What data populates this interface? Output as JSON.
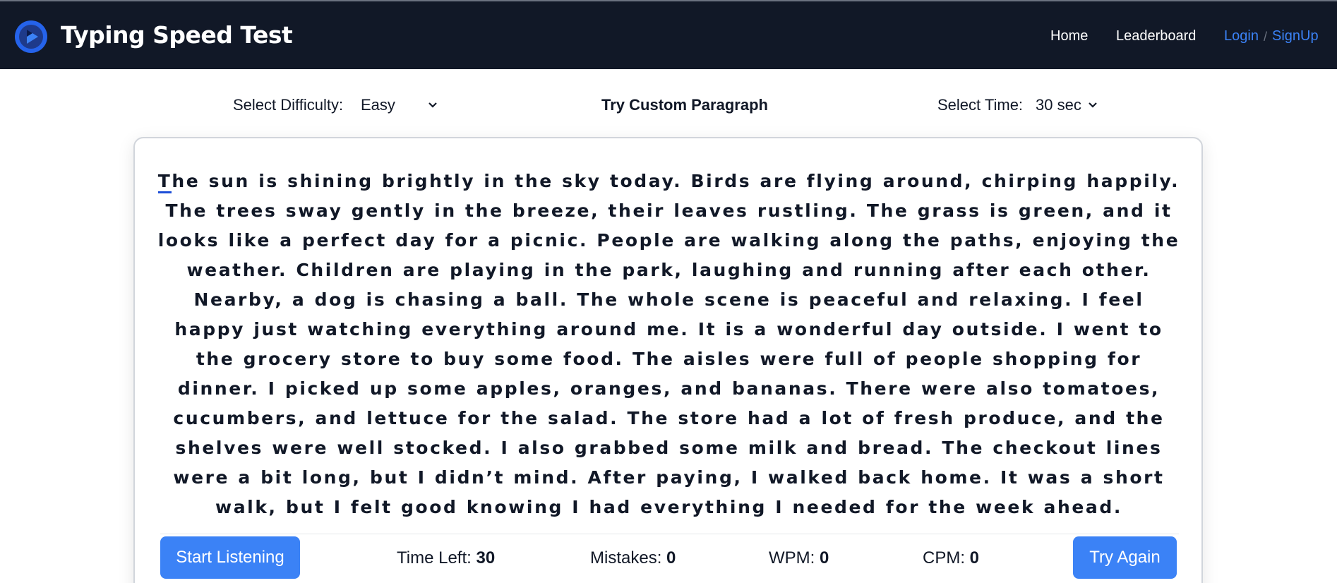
{
  "header": {
    "app_title": "Typing Speed Test",
    "logo_icon": "play-logo-icon",
    "nav": {
      "home": "Home",
      "leaderboard": "Leaderboard",
      "login": "Login",
      "separator": "/",
      "signup": "SignUp"
    }
  },
  "controls": {
    "difficulty_label": "Select Difficulty:",
    "difficulty_value": "Easy",
    "custom_paragraph": "Try Custom Paragraph",
    "time_label": "Select Time:",
    "time_value": "30 sec"
  },
  "test": {
    "first_char": "T",
    "paragraph_rest": "he sun is shining brightly in the sky today. Birds are flying around, chirping happily. The trees sway gently in the breeze, their leaves rustling. The grass is green, and it looks like a perfect day for a picnic. People are walking along the paths, enjoying the weather. Children are playing in the park, laughing and running after each other. Nearby, a dog is chasing a ball. The whole scene is peaceful and relaxing. I feel happy just watching everything around me. It is a wonderful day outside. I went to the grocery store to buy some food. The aisles were full of people shopping for dinner. I picked up some apples, oranges, and bananas. There were also tomatoes, cucumbers, and lettuce for the salad. The store had a lot of fresh produce, and the shelves were well stocked. I also grabbed some milk and bread. The checkout lines were a bit long, but I didn’t mind. After paying, I walked back home. It was a short walk, but I felt good knowing I had everything I needed for the week ahead."
  },
  "footer": {
    "start_listening": "Start Listening",
    "time_left_label": "Time Left:",
    "time_left_value": "30",
    "mistakes_label": "Mistakes:",
    "mistakes_value": "0",
    "wpm_label": "WPM:",
    "wpm_value": "0",
    "cpm_label": "CPM:",
    "cpm_value": "0",
    "try_again": "Try Again"
  },
  "colors": {
    "navbar_bg": "#111827",
    "accent": "#3b82f6",
    "cursor": "#1d4ed8"
  }
}
